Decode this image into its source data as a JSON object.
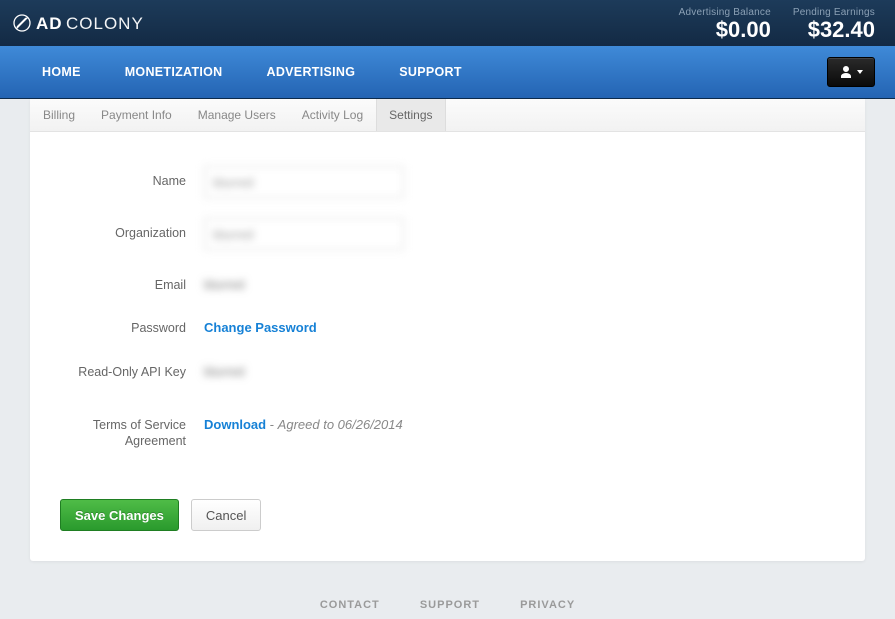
{
  "brand": "ADCOLONY",
  "topbar": {
    "balance_label": "Advertising Balance",
    "balance_value": "$0.00",
    "earnings_label": "Pending Earnings",
    "earnings_value": "$32.40"
  },
  "nav": {
    "items": [
      "HOME",
      "MONETIZATION",
      "ADVERTISING",
      "SUPPORT"
    ]
  },
  "subtabs": {
    "items": [
      "Billing",
      "Payment Info",
      "Manage Users",
      "Activity Log",
      "Settings"
    ],
    "active_index": 4
  },
  "form": {
    "name_label": "Name",
    "name_value": "blurred",
    "org_label": "Organization",
    "org_value": "blurred",
    "email_label": "Email",
    "email_value": "blurred",
    "password_label": "Password",
    "change_password": "Change Password",
    "apikey_label": "Read-Only API Key",
    "apikey_value": "blurred",
    "tos_label": "Terms of Service Agreement",
    "tos_download": "Download",
    "tos_sep": " - ",
    "tos_agreed": "Agreed to 06/26/2014"
  },
  "actions": {
    "save": "Save Changes",
    "cancel": "Cancel"
  },
  "footer": {
    "contact": "CONTACT",
    "support": "SUPPORT",
    "privacy": "PRIVACY"
  }
}
